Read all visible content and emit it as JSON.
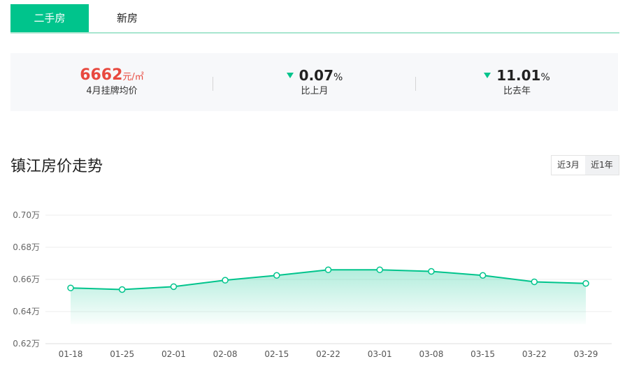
{
  "tabs": [
    {
      "label": "二手房",
      "active": true
    },
    {
      "label": "新房",
      "active": false
    }
  ],
  "stats": {
    "price": {
      "value": "6662",
      "unit": "元/㎡",
      "label": "4月挂牌均价"
    },
    "mom": {
      "value": "0.07",
      "unit": "%",
      "label": "比上月",
      "direction": "down"
    },
    "yoy": {
      "value": "11.01",
      "unit": "%",
      "label": "比去年",
      "direction": "down"
    }
  },
  "trend": {
    "title": "镇江房价走势",
    "ranges": [
      {
        "label": "近3月",
        "active": false
      },
      {
        "label": "近1年",
        "active": true
      }
    ]
  },
  "colors": {
    "accent": "#00c48c",
    "price": "#e8493f"
  },
  "chart_data": {
    "type": "area",
    "x": [
      "01-18",
      "01-25",
      "02-01",
      "02-08",
      "02-15",
      "02-22",
      "03-01",
      "03-08",
      "03-15",
      "03-22",
      "03-29"
    ],
    "series": [
      {
        "values": [
          0.6547,
          0.6537,
          0.6555,
          0.6595,
          0.6625,
          0.666,
          0.666,
          0.665,
          0.6625,
          0.6585,
          0.6575
        ]
      }
    ],
    "yticks": [
      "0.62万",
      "0.64万",
      "0.66万",
      "0.68万",
      "0.70万"
    ],
    "ylim": [
      0.62,
      0.7
    ],
    "grid": true
  }
}
